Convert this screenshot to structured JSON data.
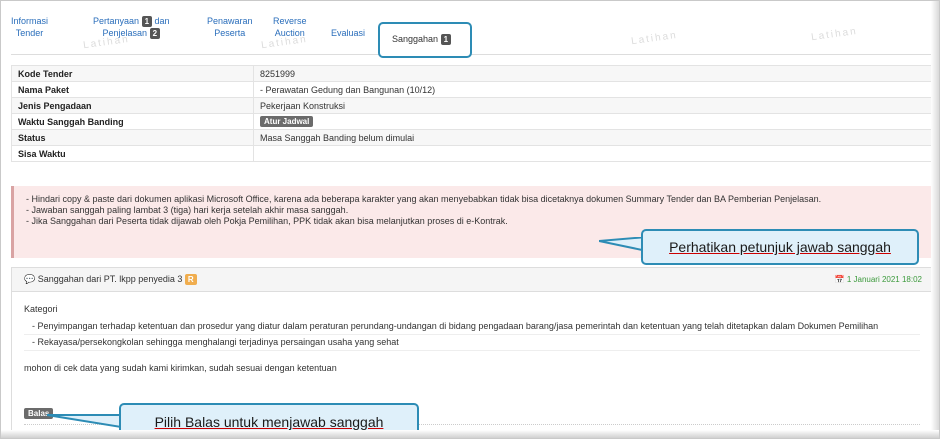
{
  "tabs": [
    {
      "line1": "Informasi",
      "line2": "Tender"
    },
    {
      "line1": "Pertanyaan",
      "badge1": "1",
      "line1b": "dan",
      "line2": "Penjelasan",
      "badge2": "2"
    },
    {
      "line1": "Penawaran",
      "line2": "Peserta"
    },
    {
      "line1": "Reverse",
      "line2": "Auction"
    },
    {
      "line1": "Evaluasi"
    }
  ],
  "active_tab": {
    "label": "Sanggahan",
    "badge": "1"
  },
  "watermark": "Latihan",
  "info": {
    "rows": [
      {
        "key": "Kode Tender",
        "value": "8251999"
      },
      {
        "key": "Nama Paket",
        "value": "- Perawatan Gedung dan Bangunan (10/12)"
      },
      {
        "key": "Jenis Pengadaan",
        "value": "Pekerjaan Konstruksi"
      },
      {
        "key": "Waktu Sanggah Banding",
        "value": "Atur Jadwal"
      },
      {
        "key": "Status",
        "value": "Masa Sanggah Banding belum dimulai"
      },
      {
        "key": "Sisa Waktu",
        "value": ""
      }
    ]
  },
  "alert": {
    "line1": "- Hindari copy & paste dari dokumen aplikasi Microsoft Office, karena ada beberapa karakter yang akan menyebabkan tidak bisa dicetaknya dokumen Summary Tender dan BA Pemberian Penjelasan.",
    "line2": "- Jawaban sanggah paling lambat 3 (tiga) hari kerja setelah akhir masa sanggah.",
    "line3": "- Jika Sanggahan dari Peserta tidak dijawab oleh Pokja Pemilihan, PPK tidak akan bisa melanjutkan proses di e-Kontrak."
  },
  "callout1": "Perhatikan petunjuk jawab sanggah",
  "comment": {
    "from": "Sanggahan dari PT. lkpp penyedia 3",
    "badge": "R",
    "date": "1 Januari 2021 18:02",
    "category_label": "Kategori",
    "items": [
      "- Penyimpangan terhadap ketentuan dan prosedur yang diatur dalam peraturan perundang-undangan di bidang pengadaan barang/jasa pemerintah dan ketentuan yang telah ditetapkan dalam Dokumen Pemilihan",
      "- Rekayasa/persekongkolan sehingga menghalangi terjadinya persaingan usaha yang sehat"
    ],
    "message": "mohon di cek data yang sudah kami kirimkan, sudah sesuai dengan ketentuan",
    "reply_label": "Balas"
  },
  "callout2": "Pilih Balas untuk menjawab sanggah",
  "colors": {
    "accent": "#2d8cb5",
    "link": "#2a6ebb",
    "alert_bg": "#fbe9e9",
    "callout_bg": "#dff0fa"
  }
}
